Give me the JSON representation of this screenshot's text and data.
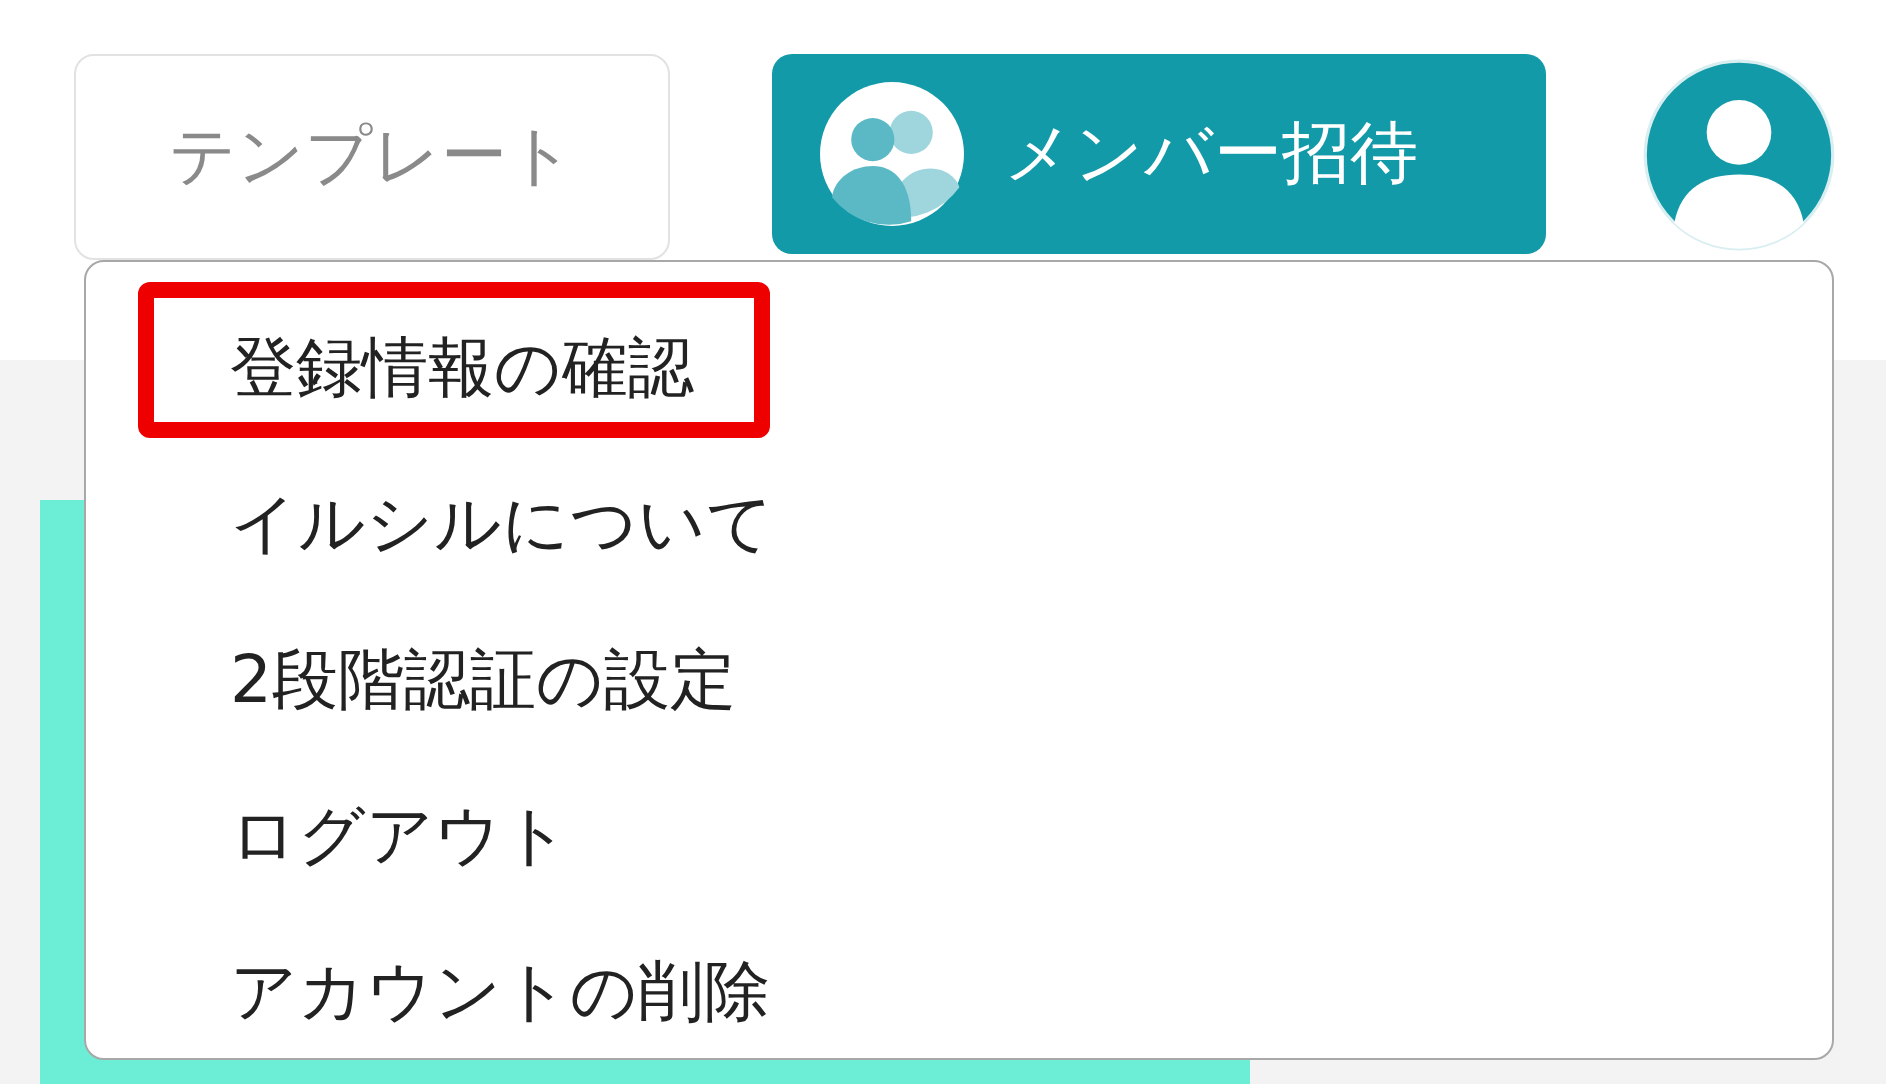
{
  "header": {
    "template_button": "テンプレート",
    "invite_button": "メンバー招待"
  },
  "account_menu": {
    "items": [
      {
        "label": "登録情報の確認",
        "highlighted": true
      },
      {
        "label": "イルシルについて",
        "highlighted": false
      },
      {
        "label": "2段階認証の設定",
        "highlighted": false
      },
      {
        "label": "ログアウト",
        "highlighted": false
      },
      {
        "label": "アカウントの削除",
        "highlighted": false
      }
    ]
  }
}
